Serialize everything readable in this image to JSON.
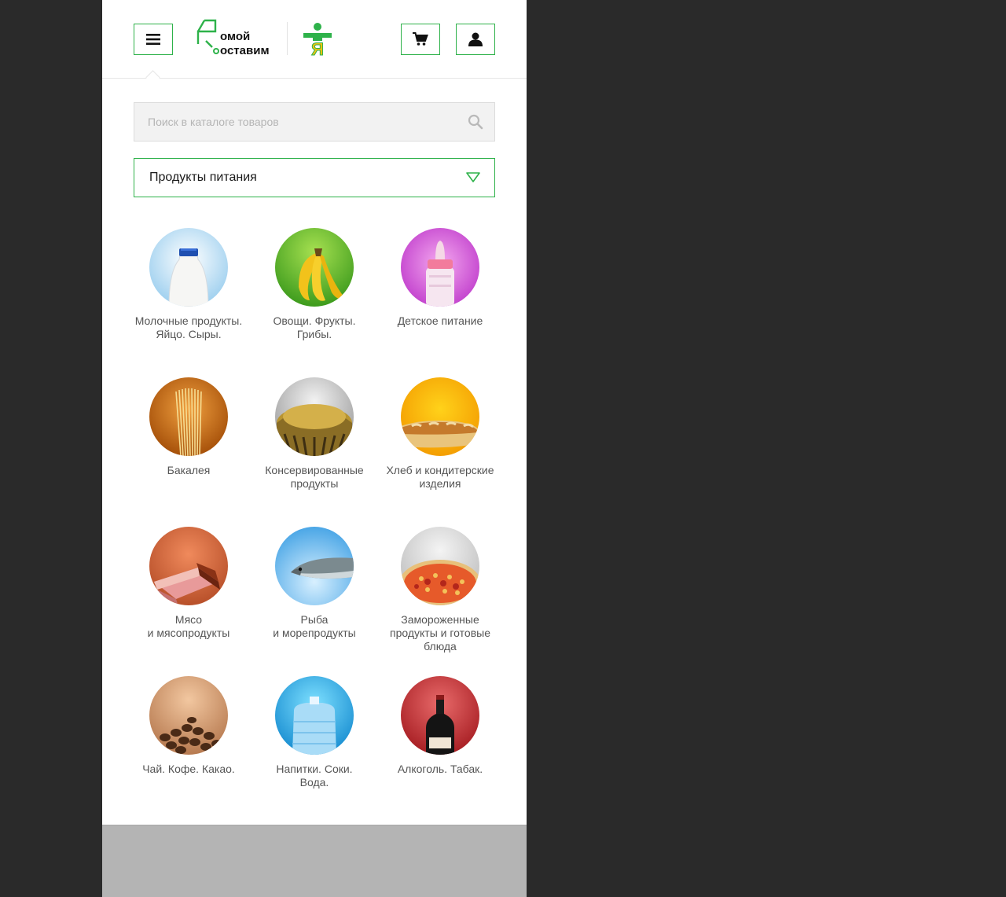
{
  "header": {
    "menu_icon": "hamburger-icon",
    "logo_text_line1": "омой",
    "logo_text_line2": "оставим",
    "partner_logo_letter": "Я",
    "cart_icon": "cart-icon",
    "user_icon": "user-icon"
  },
  "search": {
    "placeholder": "Поиск в каталоге товаров",
    "icon": "search-icon"
  },
  "category_select": {
    "value": "Продукты питания",
    "icon": "chevron-down-icon"
  },
  "categories": [
    {
      "label": "Молочные продукты.\nЯйцо. Сыры.",
      "icon": "milk-icon"
    },
    {
      "label": "Овощи. Фрукты.\nГрибы.",
      "icon": "banana-icon"
    },
    {
      "label": "Детское питание",
      "icon": "baby-bottle-icon"
    },
    {
      "label": "Бакалея",
      "icon": "pasta-icon"
    },
    {
      "label": "Консервированные\nпродукты",
      "icon": "canned-food-icon"
    },
    {
      "label": "Хлеб и кондитерские\nизделия",
      "icon": "bread-icon"
    },
    {
      "label": "Мясо\nи мясопродукты",
      "icon": "meat-icon"
    },
    {
      "label": "Рыба\nи морепродукты",
      "icon": "fish-icon"
    },
    {
      "label": "Замороженные\nпродукты и готовые\nблюда",
      "icon": "pizza-icon"
    },
    {
      "label": "Чай. Кофе. Какао.",
      "icon": "coffee-beans-icon"
    },
    {
      "label": "Напитки. Соки.\nВода.",
      "icon": "water-bottle-icon"
    },
    {
      "label": "Алкоголь. Табак.",
      "icon": "wine-bottle-icon"
    }
  ],
  "colors": {
    "accent": "#2eb24a",
    "footer": "#b4b4b4",
    "outside": "#2a2a2a"
  }
}
